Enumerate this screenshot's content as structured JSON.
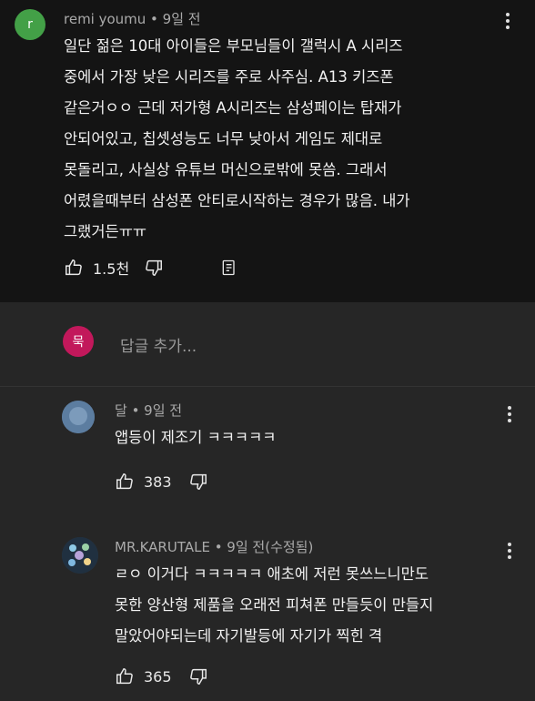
{
  "comment": {
    "avatar_letter": "r",
    "avatar_color": "#43a047",
    "meta": "remi youmu • 9일 전",
    "text": "일단 젊은 10대 아이들은 부모님들이 갤럭시 A 시리즈\n중에서 가장 낮은 시리즈를 주로 사주심. A13 키즈폰\n같은거ㅇㅇ 근데 저가형 A시리즈는 삼성페이는 탑재가\n안되어있고, 칩셋성능도 너무 낮아서 게임도 제대로\n못돌리고, 사실상 유튜브 머신으로밖에 못씀. 그래서\n어렸을때부터 삼성폰 안티로시작하는 경우가 많음. 내가\n그랬거든ㅠㅠ",
    "likes": "1.5천"
  },
  "add_reply": {
    "avatar_letter": "묵",
    "avatar_color": "#c2185b",
    "placeholder": "답글 추가..."
  },
  "replies": [
    {
      "meta": "달 • 9일 전",
      "text": "앱등이 제조기 ㅋㅋㅋㅋㅋ",
      "likes": "383"
    },
    {
      "meta": "MR.KARUTALE • 9일 전(수정됨)",
      "text": "ㄹㅇ 이거다 ㅋㅋㅋㅋㅋ 애초에 저런 못쓰느니만도\n못한 양산형 제품을 오래전 피쳐폰 만들듯이 만들지\n말았어야되는데 자기발등에 자기가 찍힌 격",
      "likes": "365"
    }
  ]
}
